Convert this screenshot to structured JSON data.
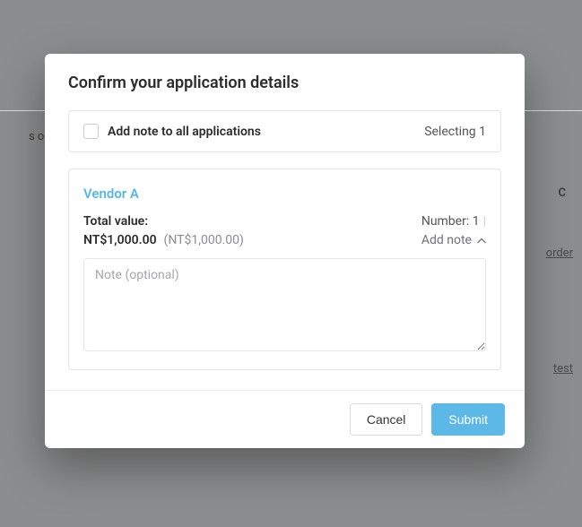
{
  "modal": {
    "title": "Confirm your application details",
    "top_panel": {
      "checkbox_label": "Add note to all applications",
      "selecting_text": "Selecting 1"
    },
    "vendor": {
      "name": "Vendor A",
      "total_label": "Total value:",
      "total_value": "NT$1,000.00",
      "total_sub": "(NT$1,000.00)",
      "number_text": "Number: 1",
      "add_note_label": "Add note",
      "note_placeholder": "Note (optional)"
    },
    "footer": {
      "cancel": "Cancel",
      "submit": "Submit"
    }
  },
  "background": {
    "s_on": "s on",
    "order_link": "order",
    "test_link": "test",
    "c_char": "C"
  }
}
